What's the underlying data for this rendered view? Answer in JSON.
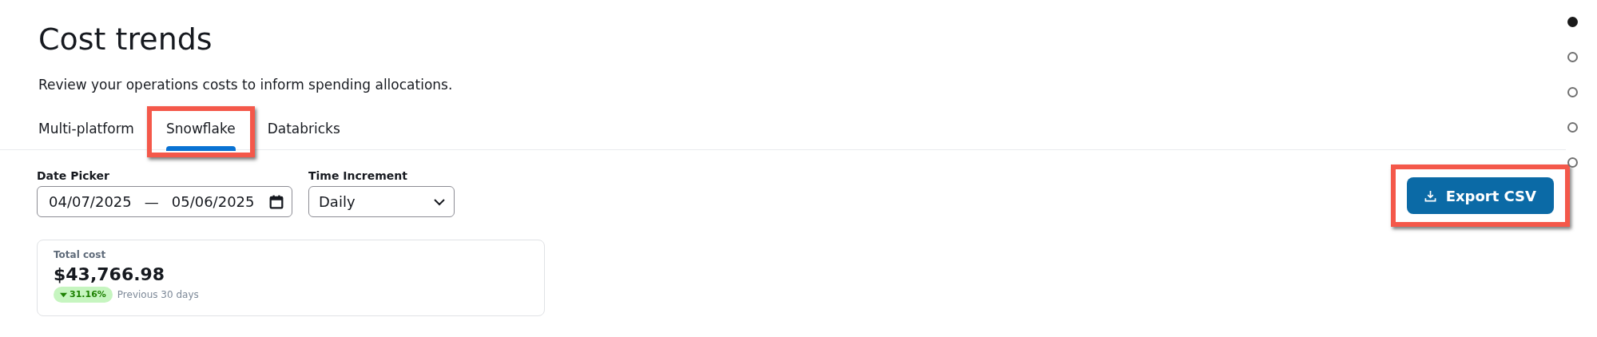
{
  "header": {
    "title": "Cost trends",
    "subtitle": "Review your operations costs to inform spending allocations."
  },
  "tabs": [
    {
      "label": "Multi-platform",
      "selected": false,
      "highlighted": false
    },
    {
      "label": "Snowflake",
      "selected": true,
      "highlighted": true
    },
    {
      "label": "Databricks",
      "selected": false,
      "highlighted": false
    }
  ],
  "date_picker": {
    "label": "Date Picker",
    "start": "04/07/2025",
    "separator": "—",
    "end": "05/06/2025"
  },
  "time_increment": {
    "label": "Time Increment",
    "value": "Daily"
  },
  "export_button": {
    "label": "Export CSV",
    "highlighted": true
  },
  "total_cost": {
    "label": "Total cost",
    "value": "$43,766.98",
    "change": "31.16%",
    "period": "Previous 30 days"
  },
  "page_dots": [
    {
      "selected": true
    },
    {
      "selected": false
    },
    {
      "selected": false
    },
    {
      "selected": false
    },
    {
      "selected": false
    }
  ]
}
